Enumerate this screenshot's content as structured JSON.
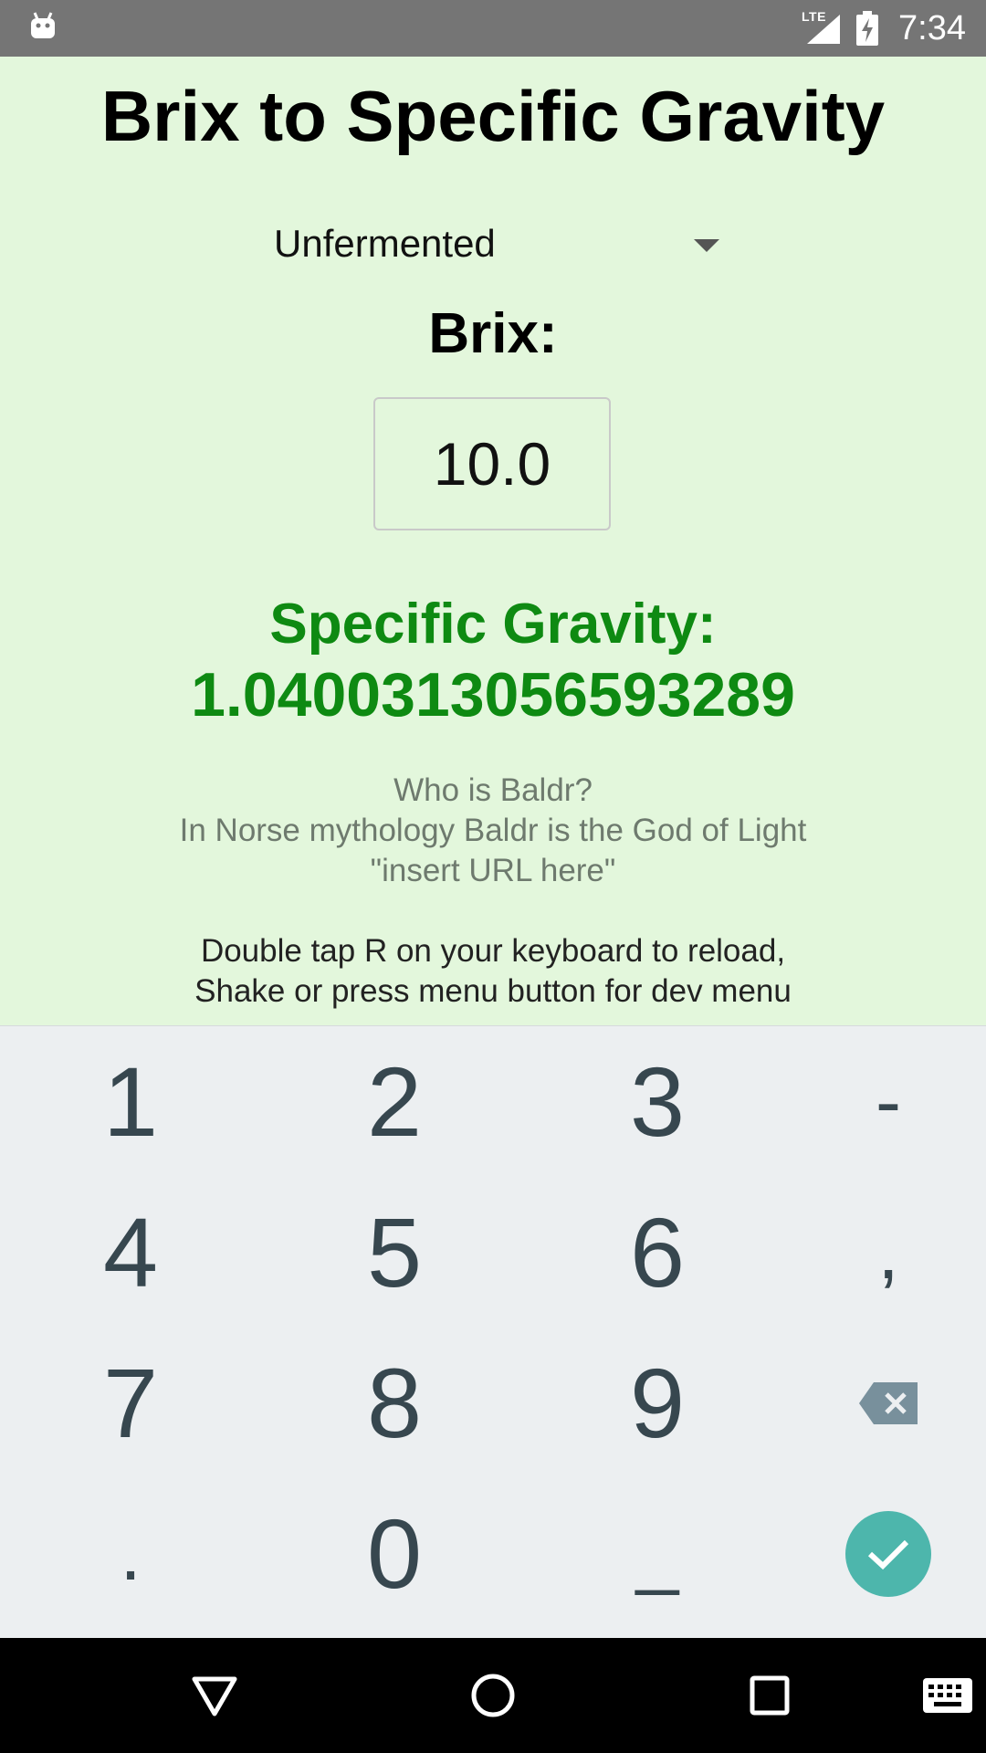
{
  "status_bar": {
    "network": "LTE",
    "time": "7:34"
  },
  "app": {
    "title": "Brix to Specific Gravity",
    "mode_select": {
      "selected": "Unfermented"
    },
    "brix_label": "Brix:",
    "brix_input": {
      "value": "10.0"
    },
    "sg_label": "Specific Gravity:",
    "sg_value": "1.0400313056593289",
    "info_lines": [
      "Who is Baldr?",
      "In Norse mythology Baldr is the God of Light",
      "\"insert URL here\""
    ],
    "dev_hint_lines": [
      "Double tap R on your keyboard to reload,",
      "Shake or press menu button for dev menu"
    ]
  },
  "keyboard": {
    "row1": [
      "1",
      "2",
      "3",
      "-"
    ],
    "row2": [
      "4",
      "5",
      "6",
      ","
    ],
    "row3": [
      "7",
      "8",
      "9"
    ],
    "row4": [
      ".",
      "0",
      "_"
    ],
    "backspace_icon": "backspace-icon",
    "done_icon": "check-icon",
    "colors": {
      "key_text": "#37474f",
      "done": "#4db6ac",
      "background": "#eceff1"
    }
  },
  "nav_bar": {
    "icons": [
      "back-icon",
      "home-icon",
      "recents-icon",
      "keyboard-switch-icon"
    ]
  },
  "colors": {
    "app_background": "#e3f7dc",
    "result_green": "#0e8a12",
    "status_bar": "#757575"
  }
}
